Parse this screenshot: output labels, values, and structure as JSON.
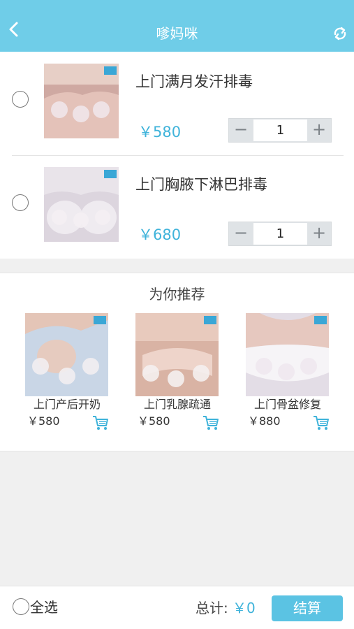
{
  "header": {
    "title": "嗲妈咪",
    "back_icon": "chevron-left-icon",
    "refresh_icon": "refresh-icon",
    "bg_color": "#6fcde8"
  },
  "cart": {
    "items": [
      {
        "name": "上门满月发汗排毒",
        "price": "￥580",
        "quantity": "1",
        "selected": false
      },
      {
        "name": "上门胸腋下淋巴排毒",
        "price": "￥680",
        "quantity": "1",
        "selected": false
      }
    ],
    "stepper": {
      "minus": "−",
      "plus": "+"
    }
  },
  "recommend": {
    "title": "为你推荐",
    "items": [
      {
        "name": "上门产后开奶",
        "price": "￥580",
        "cart_icon": "cart-icon"
      },
      {
        "name": "上门乳腺疏通",
        "price": "￥580",
        "cart_icon": "cart-icon"
      },
      {
        "name": "上门骨盆修复",
        "price": "￥880",
        "cart_icon": "cart-icon"
      }
    ]
  },
  "bottom": {
    "select_all": "全选",
    "total_label": "总计:",
    "total_value": "￥0",
    "checkout": "结算"
  },
  "colors": {
    "accent": "#3fb3da",
    "button": "#5bc3e3"
  }
}
